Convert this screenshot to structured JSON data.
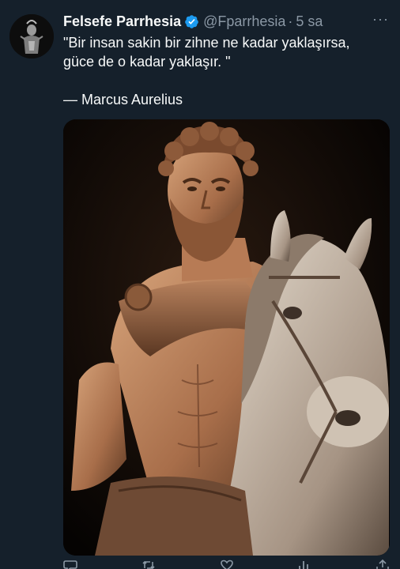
{
  "tweet": {
    "display_name": "Felsefe Parrhesia",
    "handle": "@Fparrhesia",
    "separator": "·",
    "time": "5 sa",
    "more": "···",
    "text_line1": "\"Bir insan sakin bir zihne ne kadar yaklaşırsa,",
    "text_line2": "güce de o kadar yaklaşır. \"",
    "author_line": "— Marcus Aurelius"
  },
  "colors": {
    "background": "#15202b",
    "verified": "#1d9bf0",
    "secondary_text": "#8b98a5"
  },
  "icons": [
    "verified-badge-icon",
    "more-icon",
    "reply-icon",
    "retweet-icon",
    "like-icon",
    "views-icon",
    "share-icon"
  ]
}
